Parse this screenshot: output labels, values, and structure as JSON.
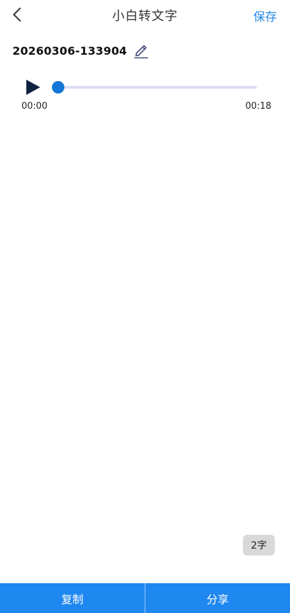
{
  "header": {
    "back_icon": "chevron-left-icon",
    "title": "小白转文字",
    "save_label": "保存"
  },
  "recording": {
    "name": "20260306-133904",
    "edit_icon": "pencil-icon"
  },
  "player": {
    "play_icon": "play-icon",
    "current_time": "00:00",
    "total_time": "00:18",
    "progress_fraction": 0
  },
  "transcript": {
    "text": ""
  },
  "word_count": "2字",
  "footer": {
    "copy_label": "复制",
    "share_label": "分享"
  },
  "colors": {
    "accent": "#1f87e5",
    "bottom_bar": "#1f87f0",
    "track": "#dcdcf5",
    "play_icon": "#0f2340",
    "badge_bg": "#d9d9d9"
  }
}
